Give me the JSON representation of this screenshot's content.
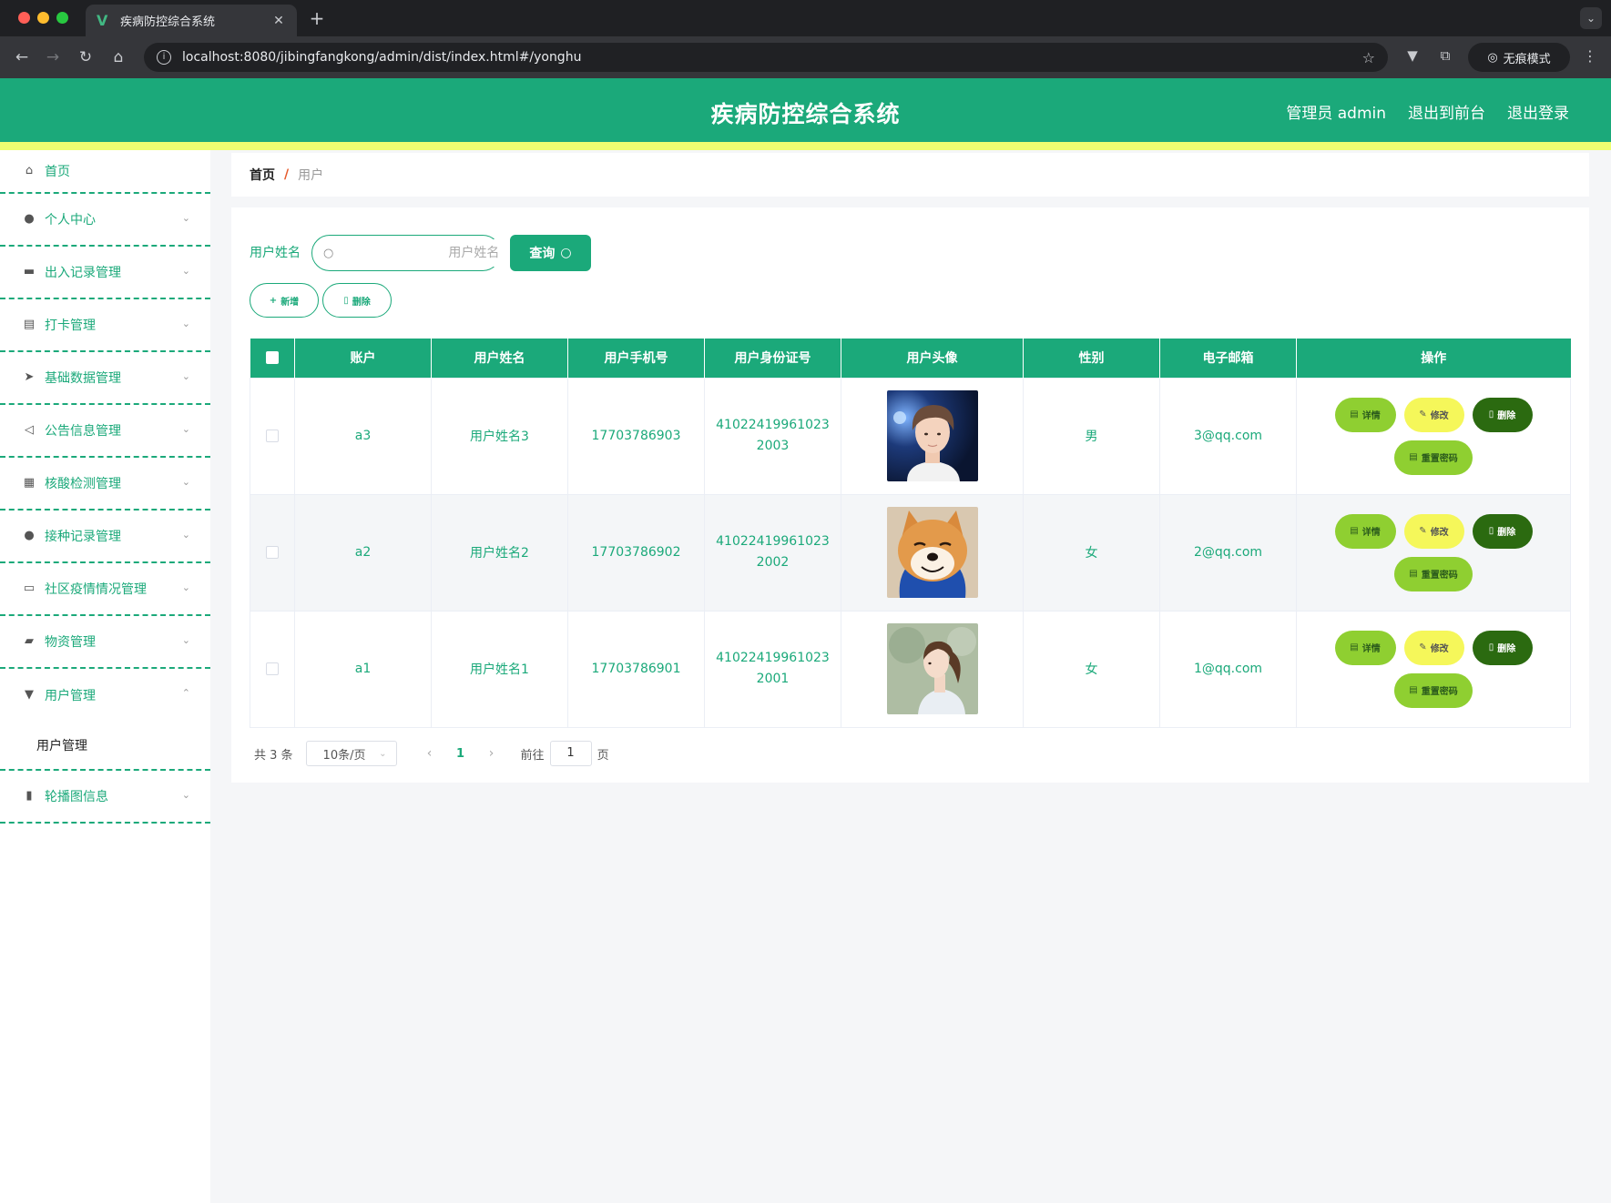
{
  "browser": {
    "tab_title": "疾病防控综合系统",
    "url": "localhost:8080/jibingfangkong/admin/dist/index.html#/yonghu",
    "incognito_label": "无痕模式"
  },
  "header": {
    "title": "疾病防控综合系统",
    "user_label": "管理员 admin",
    "to_front": "退出到前台",
    "logout": "退出登录"
  },
  "sidebar": {
    "items": [
      {
        "label": "首页",
        "icon": "home-icon"
      },
      {
        "label": "个人中心",
        "icon": "user-icon"
      },
      {
        "label": "出入记录管理",
        "icon": "printer-icon"
      },
      {
        "label": "打卡管理",
        "icon": "wallet-icon"
      },
      {
        "label": "基础数据管理",
        "icon": "send-icon"
      },
      {
        "label": "公告信息管理",
        "icon": "position-icon"
      },
      {
        "label": "核酸检测管理",
        "icon": "briefcase-icon"
      },
      {
        "label": "接种记录管理",
        "icon": "user-icon"
      },
      {
        "label": "社区疫情情况管理",
        "icon": "chat-icon"
      },
      {
        "label": "物资管理",
        "icon": "comment-icon"
      },
      {
        "label": "用户管理",
        "icon": "stamp-icon",
        "sub": "用户管理"
      },
      {
        "label": "轮播图信息",
        "icon": "chart-icon"
      }
    ]
  },
  "breadcrumb": {
    "home": "首页",
    "separator": "/",
    "current": "用户"
  },
  "search": {
    "label": "用户姓名",
    "placeholder": "用户姓名",
    "button": "查询"
  },
  "actions": {
    "add": "新增",
    "delete": "删除"
  },
  "table": {
    "columns": [
      "账户",
      "用户姓名",
      "用户手机号",
      "用户身份证号",
      "用户头像",
      "性别",
      "电子邮箱",
      "操作"
    ],
    "rows": [
      {
        "account": "a3",
        "name": "用户姓名3",
        "phone": "17703786903",
        "idcard": "410224199610232003",
        "avatar": "young-man-avatar",
        "gender": "男",
        "email": "3@qq.com"
      },
      {
        "account": "a2",
        "name": "用户姓名2",
        "phone": "17703786902",
        "idcard": "410224199610232002",
        "avatar": "shiba-dog-avatar",
        "gender": "女",
        "email": "2@qq.com"
      },
      {
        "account": "a1",
        "name": "用户姓名1",
        "phone": "17703786901",
        "idcard": "410224199610232001",
        "avatar": "young-woman-avatar",
        "gender": "女",
        "email": "1@qq.com"
      }
    ],
    "ops": {
      "detail": "详情",
      "edit": "修改",
      "delete": "删除",
      "reset": "重置密码"
    }
  },
  "pager": {
    "total": "共 3 条",
    "page_size": "10条/页",
    "current_page": "1",
    "goto_label": "前往",
    "goto_value": "1",
    "page_unit": "页"
  },
  "colors": {
    "primary": "#1ba97a",
    "stripe": "#eefe71",
    "detail": "#8fcf31",
    "edit": "#f5f75a",
    "delete": "#2b6a10"
  }
}
